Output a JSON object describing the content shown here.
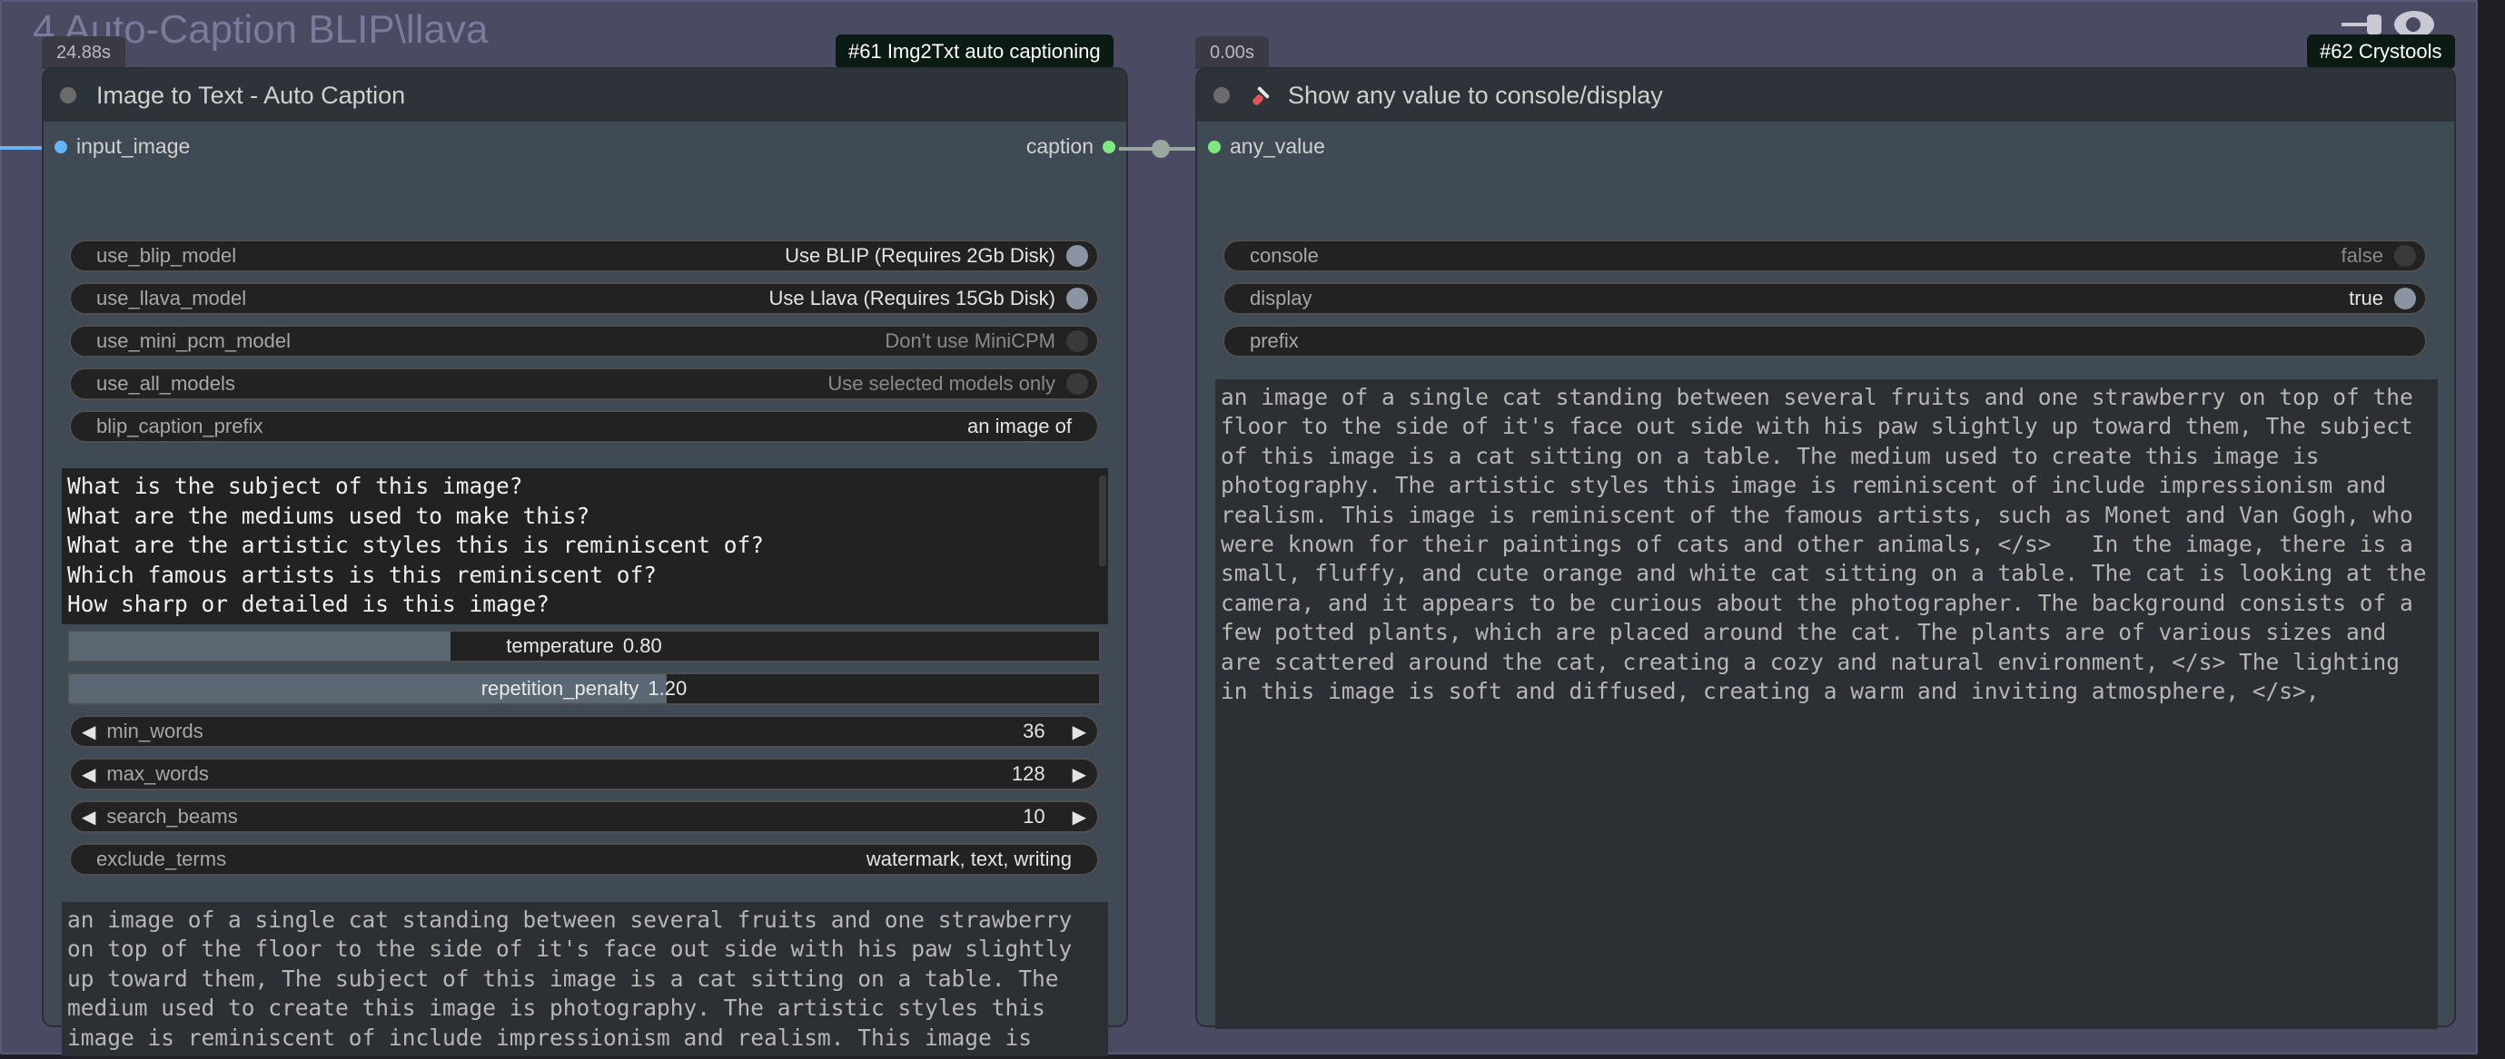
{
  "group": {
    "title": "4 Auto-Caption BLIP\\llava"
  },
  "node61": {
    "timing": "24.88s",
    "badge": "#61 Img2Txt auto captioning",
    "title": "Image to Text - Auto Caption",
    "input_slot": "input_image",
    "output_slot": "caption",
    "widgets": {
      "use_blip_model": {
        "label": "use_blip_model",
        "value": "Use BLIP (Requires 2Gb Disk)"
      },
      "use_llava_model": {
        "label": "use_llava_model",
        "value": "Use Llava (Requires 15Gb Disk)"
      },
      "use_mini_pcm_model": {
        "label": "use_mini_pcm_model",
        "value": "Don't use MiniCPM"
      },
      "use_all_models": {
        "label": "use_all_models",
        "value": "Use selected models only"
      },
      "blip_caption_prefix": {
        "label": "blip_caption_prefix",
        "value": "an image of"
      },
      "temperature": {
        "label": "temperature",
        "value": "0.80",
        "fraction": 0.37
      },
      "repetition_penalty": {
        "label": "repetition_penalty",
        "value": "1.20",
        "fraction": 0.58
      },
      "min_words": {
        "label": "min_words",
        "value": "36"
      },
      "max_words": {
        "label": "max_words",
        "value": "128"
      },
      "search_beams": {
        "label": "search_beams",
        "value": "10"
      },
      "exclude_terms": {
        "label": "exclude_terms",
        "value": "watermark, text, writing"
      }
    },
    "questions": "What is the subject of this image?\nWhat are the mediums used to make this?\nWhat are the artistic styles this is reminiscent of?\nWhich famous artists is this reminiscent of?\nHow sharp or detailed is this image?\nWhat is the environment and background of this image?",
    "output": "an image of a single cat standing between several fruits and one strawberry on top of the floor to the side of it's face out side with his paw slightly up toward them, The subject of this image is a cat sitting on a table. The medium used to create this image is photography. The artistic styles this image is reminiscent of include impressionism and realism. This image is reminiscent of the famous artists, such as Monet and Van Gogh, who"
  },
  "node62": {
    "timing": "0.00s",
    "badge": "#62 Crystools",
    "title": "Show any value to console/display",
    "title_icon": "paintbrush-icon",
    "input_slot": "any_value",
    "widgets": {
      "console": {
        "label": "console",
        "value": "false"
      },
      "display": {
        "label": "display",
        "value": "true"
      },
      "prefix": {
        "label": "prefix",
        "value": ""
      }
    },
    "output": "an image of a single cat standing between several fruits and one strawberry on top of the floor to the side of it's face out side with his paw slightly up toward them, The subject of this image is a cat sitting on a table. The medium used to create this image is photography. The artistic styles this image is reminiscent of include impressionism and realism. This image is reminiscent of the famous artists, such as Monet and Van Gogh, who were known for their paintings of cats and other animals, </s>   In the image, there is a small, fluffy, and cute orange and white cat sitting on a table. The cat is looking at the camera, and it appears to be curious about the photographer. The background consists of a few potted plants, which are placed around the cat. The plants are of various sizes and are scattered around the cat, creating a cozy and natural environment, </s> The lighting in this image is soft and diffused, creating a warm and inviting atmosphere, </s>,"
  },
  "colors": {
    "image_slot": "#64b5f6",
    "string_slot": "#7ee87e",
    "link": "#9aa7a0",
    "badge_bg": "#0c1a14"
  }
}
